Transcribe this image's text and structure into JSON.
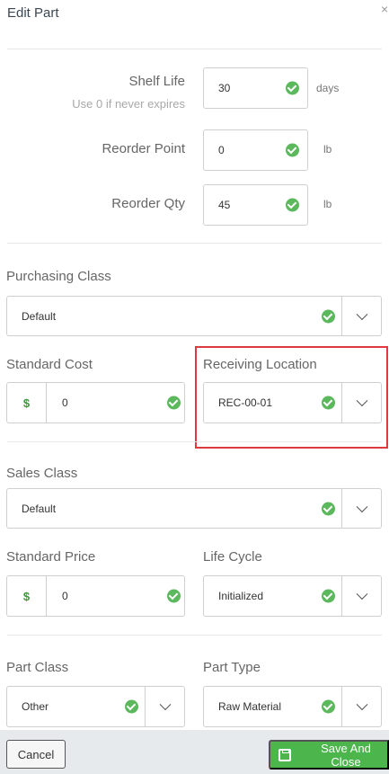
{
  "title": "Edit Part",
  "close_glyph": "×",
  "shelf_life": {
    "label": "Shelf Life",
    "hint": "Use 0 if never expires",
    "value": "30",
    "unit": "days"
  },
  "reorder_point": {
    "label": "Reorder Point",
    "value": "0",
    "unit": "lb"
  },
  "reorder_qty": {
    "label": "Reorder Qty",
    "value": "45",
    "unit": "lb"
  },
  "purchasing_class": {
    "label": "Purchasing Class",
    "value": "Default"
  },
  "standard_cost": {
    "label": "Standard Cost",
    "currency": "$",
    "value": "0"
  },
  "receiving_location": {
    "label": "Receiving Location",
    "value": "REC-00-01"
  },
  "sales_class": {
    "label": "Sales Class",
    "value": "Default"
  },
  "standard_price": {
    "label": "Standard Price",
    "currency": "$",
    "value": "0"
  },
  "life_cycle": {
    "label": "Life Cycle",
    "value": "Initialized"
  },
  "part_class": {
    "label": "Part Class",
    "value": "Other"
  },
  "part_type": {
    "label": "Part Type",
    "value": "Raw Material"
  },
  "footer": {
    "cancel_label": "Cancel",
    "save_label": "Save And Close"
  },
  "colors": {
    "valid_check": "#5cb85c",
    "save_button": "#4cb54c",
    "highlight_border": "#e0393e",
    "footer_bg": "#e6eaec"
  },
  "icons": [
    "close-icon",
    "check-icon",
    "chevron-down-icon",
    "dollar-icon",
    "save-icon"
  ]
}
